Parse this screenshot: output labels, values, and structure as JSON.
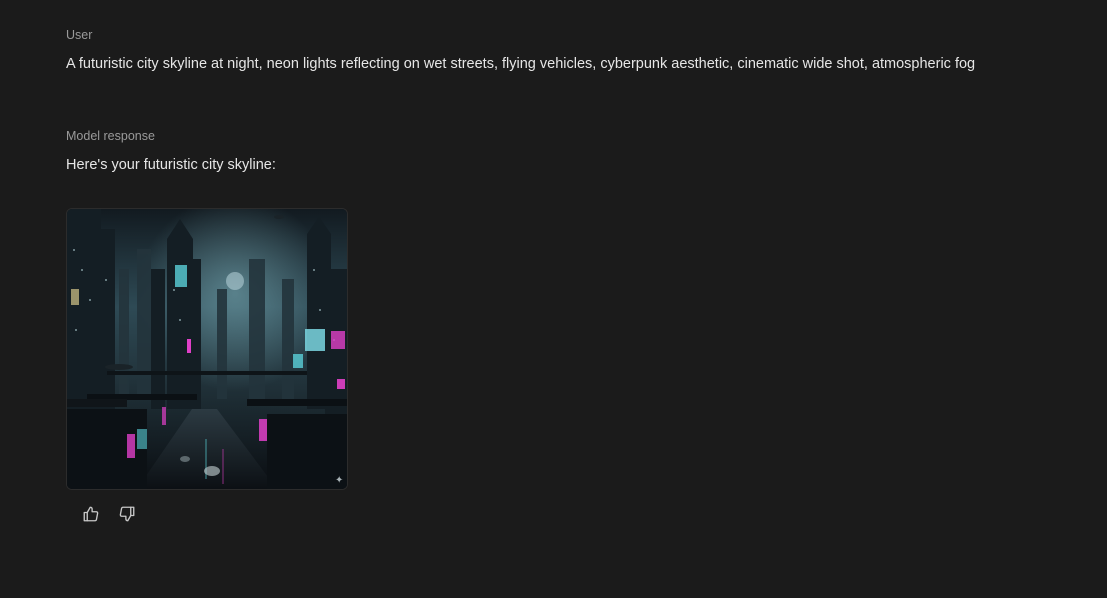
{
  "conversation": {
    "user": {
      "label": "User",
      "text": "A futuristic city skyline at night, neon lights reflecting on wet streets, flying vehicles, cyberpunk aesthetic, cinematic wide shot, atmospheric fog"
    },
    "model": {
      "label": "Model response",
      "text": "Here's your futuristic city skyline:"
    }
  },
  "icons": {
    "like": "thumbs-up-icon",
    "dislike": "thumbs-down-icon",
    "image_corner": "sparkle-icon"
  },
  "colors": {
    "background": "#1b1b1b",
    "label": "#9a9a9a",
    "text": "#e6e6e6",
    "neon_pink": "#e040c8",
    "neon_cyan": "#5ad0d8"
  }
}
